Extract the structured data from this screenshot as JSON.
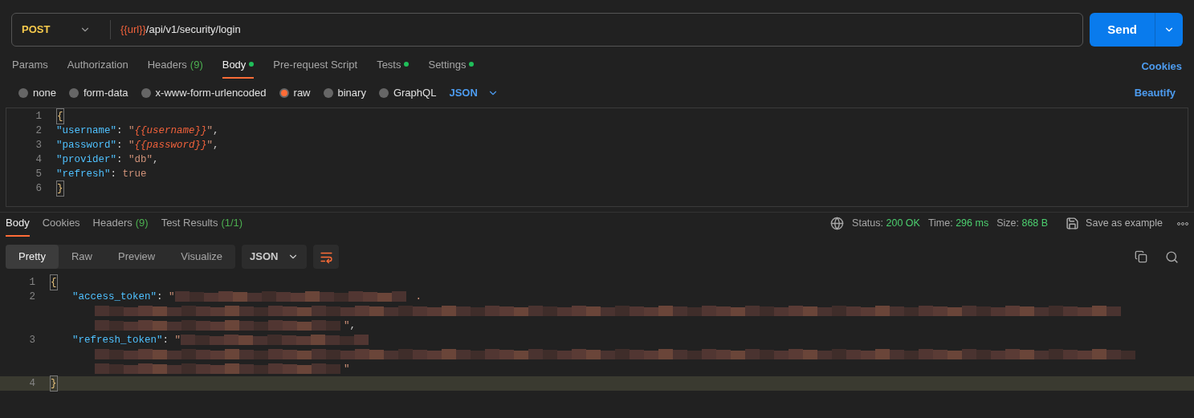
{
  "request": {
    "method": "POST",
    "url_variable": "{{url}}",
    "url_path": "/api/v1/security/login",
    "send": "Send"
  },
  "request_tabs": [
    {
      "label": "Params",
      "selected": false,
      "dot": false
    },
    {
      "label": "Authorization",
      "selected": false,
      "dot": false
    },
    {
      "label": "Headers",
      "count": "(9)",
      "selected": false,
      "dot": false
    },
    {
      "label": "Body",
      "selected": true,
      "dot": true
    },
    {
      "label": "Pre-request Script",
      "selected": false,
      "dot": false
    },
    {
      "label": "Tests",
      "selected": false,
      "dot": true
    },
    {
      "label": "Settings",
      "selected": false,
      "dot": true
    }
  ],
  "cookies_link": "Cookies",
  "body_types": [
    {
      "label": "none",
      "selected": false
    },
    {
      "label": "form-data",
      "selected": false
    },
    {
      "label": "x-www-form-urlencoded",
      "selected": false
    },
    {
      "label": "raw",
      "selected": true
    },
    {
      "label": "binary",
      "selected": false
    },
    {
      "label": "GraphQL",
      "selected": false
    }
  ],
  "body_format": "JSON",
  "beautify": "Beautify",
  "request_body": [
    {
      "number": "1",
      "tokens": [
        {
          "kind": "brace",
          "text": "{"
        }
      ]
    },
    {
      "number": "2",
      "tokens": [
        {
          "kind": "key",
          "text": "\"username\""
        },
        {
          "kind": "punct",
          "text": ": "
        },
        {
          "kind": "string",
          "text": "\""
        },
        {
          "kind": "var",
          "text": "{{username}}"
        },
        {
          "kind": "string",
          "text": "\""
        },
        {
          "kind": "punct",
          "text": ","
        }
      ]
    },
    {
      "number": "3",
      "tokens": [
        {
          "kind": "key",
          "text": "\"password\""
        },
        {
          "kind": "punct",
          "text": ": "
        },
        {
          "kind": "string",
          "text": "\""
        },
        {
          "kind": "var",
          "text": "{{password}}"
        },
        {
          "kind": "string",
          "text": "\""
        },
        {
          "kind": "punct",
          "text": ","
        }
      ]
    },
    {
      "number": "4",
      "tokens": [
        {
          "kind": "key",
          "text": "\"provider\""
        },
        {
          "kind": "punct",
          "text": ": "
        },
        {
          "kind": "string",
          "text": "\"db\""
        },
        {
          "kind": "punct",
          "text": ","
        }
      ]
    },
    {
      "number": "5",
      "tokens": [
        {
          "kind": "key",
          "text": "\"refresh\""
        },
        {
          "kind": "punct",
          "text": ": "
        },
        {
          "kind": "literal",
          "text": "true"
        }
      ]
    },
    {
      "number": "6",
      "tokens": [
        {
          "kind": "brace",
          "text": "}"
        }
      ]
    }
  ],
  "response_tabs": [
    {
      "label": "Body",
      "selected": true
    },
    {
      "label": "Cookies",
      "selected": false
    },
    {
      "label": "Headers",
      "count": "(9)",
      "selected": false
    },
    {
      "label": "Test Results",
      "count": "(1/1)",
      "selected": false
    }
  ],
  "status": [
    {
      "label": "Status:",
      "value": "200 OK"
    },
    {
      "label": "Time:",
      "value": "296 ms"
    },
    {
      "label": "Size:",
      "value": "868 B"
    }
  ],
  "save_example": "Save as example",
  "view_modes": [
    {
      "label": "Pretty",
      "selected": true
    },
    {
      "label": "Raw",
      "selected": false
    },
    {
      "label": "Preview",
      "selected": false
    },
    {
      "label": "Visualize",
      "selected": false
    }
  ],
  "response_format": "JSON",
  "response_body": [
    {
      "number": "1",
      "tokens": [
        {
          "kind": "brace",
          "text": "{"
        }
      ]
    },
    {
      "number": "2",
      "tokens": [
        {
          "kind": "indent"
        },
        {
          "kind": "key",
          "text": "\"access_token\""
        },
        {
          "kind": "punct",
          "text": ": "
        },
        {
          "kind": "string",
          "text": "\""
        },
        {
          "kind": "redacted"
        },
        {
          "kind": "string",
          "text": "."
        }
      ]
    },
    {
      "tokens": [
        {
          "kind": "indent2"
        },
        {
          "kind": "redacted"
        }
      ]
    },
    {
      "tokens": [
        {
          "kind": "indent2"
        },
        {
          "kind": "redacted"
        },
        {
          "kind": "string",
          "text": "\""
        },
        {
          "kind": "punct",
          "text": ","
        }
      ]
    },
    {
      "number": "3",
      "tokens": [
        {
          "kind": "indent"
        },
        {
          "kind": "key",
          "text": "\"refresh_token\""
        },
        {
          "kind": "punct",
          "text": ": "
        },
        {
          "kind": "string",
          "text": "\""
        },
        {
          "kind": "redacted"
        }
      ]
    },
    {
      "tokens": [
        {
          "kind": "indent2"
        },
        {
          "kind": "redacted"
        }
      ]
    },
    {
      "tokens": [
        {
          "kind": "indent2"
        },
        {
          "kind": "redacted"
        },
        {
          "kind": "string",
          "text": "\""
        }
      ]
    },
    {
      "number": "4",
      "tokens": [
        {
          "kind": "brace",
          "text": "}"
        }
      ],
      "highlighted": true
    }
  ]
}
